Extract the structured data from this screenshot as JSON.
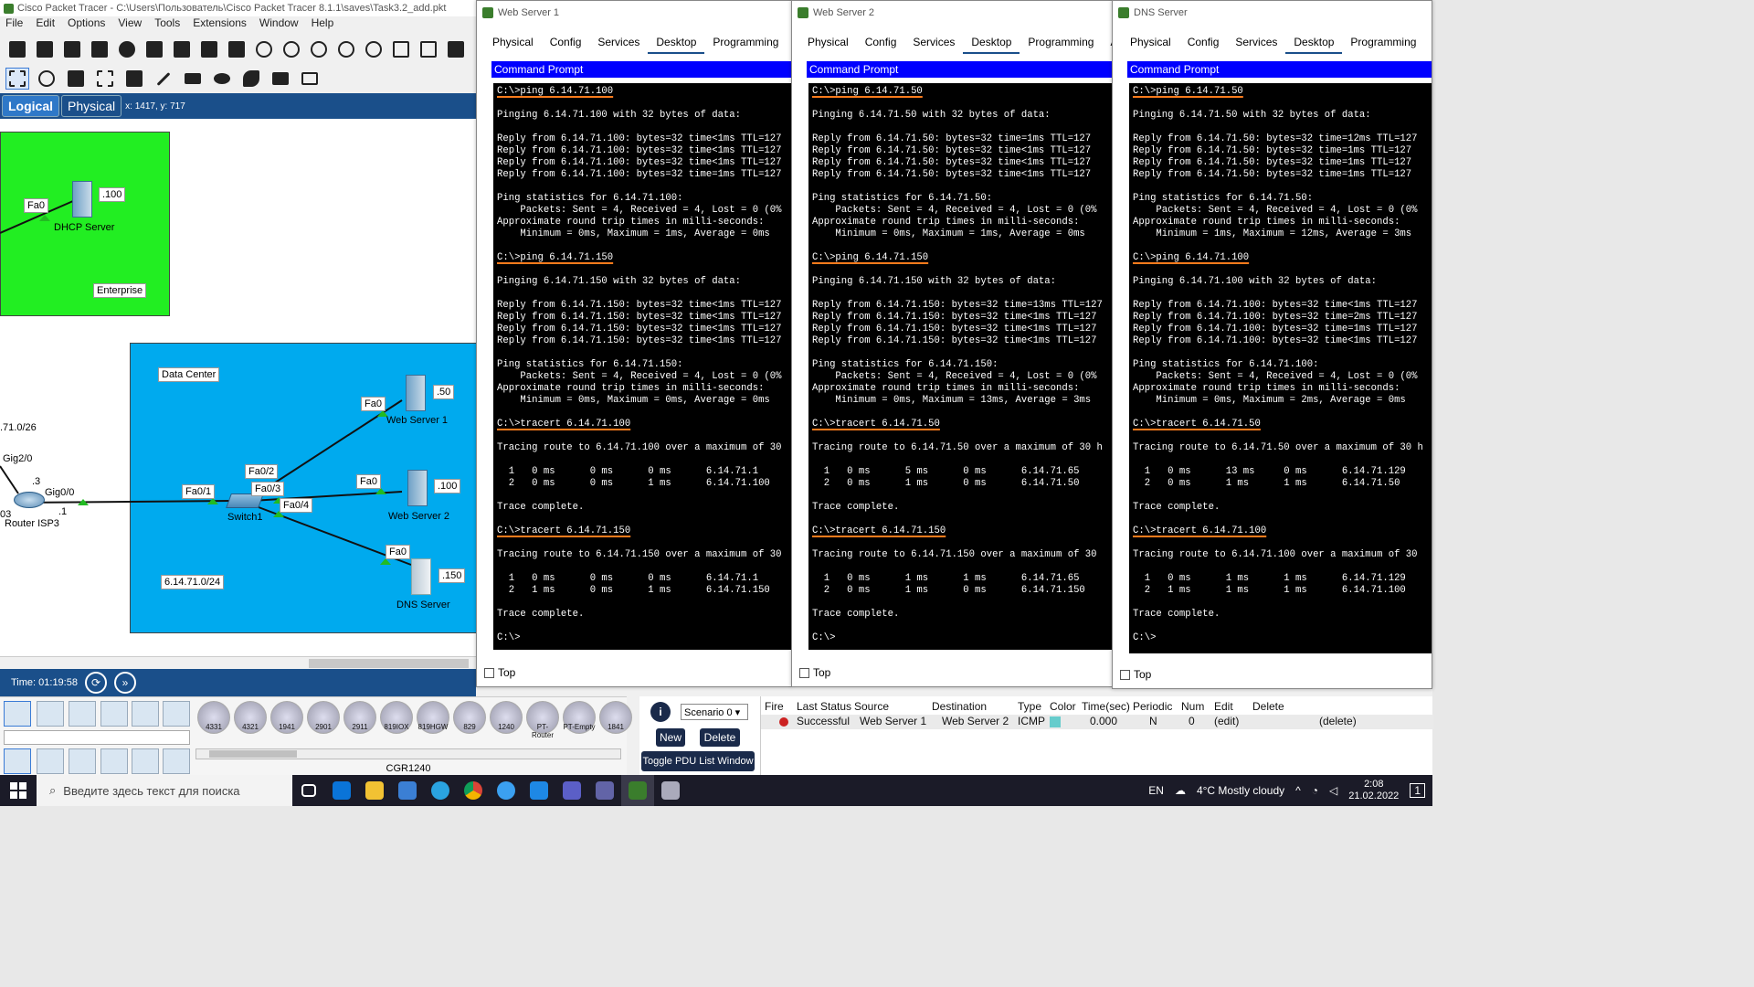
{
  "app": {
    "title": "Cisco Packet Tracer - C:\\Users\\Пользователь\\Cisco Packet Tracer 8.1.1\\saves\\Task3.2_add.pkt",
    "menu": [
      "File",
      "Edit",
      "Options",
      "View",
      "Tools",
      "Extensions",
      "Window",
      "Help"
    ],
    "mode_tabs": {
      "logical": "Logical",
      "physical": "Physical"
    },
    "coords": "x: 1417, y: 717",
    "time": "Time: 01:19:58"
  },
  "topology": {
    "zones": {
      "enterprise": "Enterprise",
      "datacenter": "Data Center",
      "subnet": "6.14.71.0/24",
      "isp_net": ".71.0/26"
    },
    "dhcp": {
      "name": "DHCP Server",
      "ip": ".100",
      "port": "Fa0"
    },
    "web1": {
      "name": "Web Server 1",
      "ip": ".50",
      "port": "Fa0"
    },
    "web2": {
      "name": "Web Server 2",
      "ip": ".100",
      "port": "Fa0"
    },
    "dns": {
      "name": "DNS Server",
      "ip": ".150",
      "port": "Fa0"
    },
    "switch": {
      "name": "Switch1",
      "p1": "Fa0/1",
      "p2": "Fa0/2",
      "p3": "Fa0/3",
      "p4": "Fa0/4"
    },
    "router": {
      "name": "Router ISP3",
      "g20": "Gig2/0",
      "g00": "Gig0/0",
      "a3": ".3",
      "a1": ".1",
      "a03": "03"
    }
  },
  "devices": {
    "models": [
      "4331",
      "4321",
      "1941",
      "2901",
      "2911",
      "819IOX",
      "819HGW",
      "829",
      "1240",
      "PT-Router",
      "PT-Empty",
      "1841"
    ],
    "selected": "CGR1240"
  },
  "scenario": {
    "select": "Scenario 0",
    "new": "New",
    "delete": "Delete",
    "toggle": "Toggle PDU List Window"
  },
  "pdu": {
    "headers": [
      "Fire",
      "Last Status",
      "Source",
      "Destination",
      "Type",
      "Color",
      "Time(sec)",
      "Periodic",
      "Num",
      "Edit",
      "Delete"
    ],
    "row": {
      "status": "Successful",
      "source": "Web Server 1",
      "dest": "Web Server 2",
      "type": "ICMP",
      "color": "#66cccc",
      "time": "0.000",
      "periodic": "N",
      "num": "0",
      "edit": "(edit)",
      "delete": "(delete)"
    }
  },
  "win_tabs": [
    "Physical",
    "Config",
    "Services",
    "Desktop",
    "Programming",
    "Attri"
  ],
  "windows": [
    {
      "title": "Web Server 1",
      "cmd": "Command Prompt",
      "top": "Top",
      "lines": [
        "C:\\>ping 6.14.71.100",
        "",
        "Pinging 6.14.71.100 with 32 bytes of data:",
        "",
        "Reply from 6.14.71.100: bytes=32 time<1ms TTL=127",
        "Reply from 6.14.71.100: bytes=32 time<1ms TTL=127",
        "Reply from 6.14.71.100: bytes=32 time<1ms TTL=127",
        "Reply from 6.14.71.100: bytes=32 time=1ms TTL=127",
        "",
        "Ping statistics for 6.14.71.100:",
        "    Packets: Sent = 4, Received = 4, Lost = 0 (0%",
        "Approximate round trip times in milli-seconds:",
        "    Minimum = 0ms, Maximum = 1ms, Average = 0ms",
        "",
        "C:\\>ping 6.14.71.150",
        "",
        "Pinging 6.14.71.150 with 32 bytes of data:",
        "",
        "Reply from 6.14.71.150: bytes=32 time<1ms TTL=127",
        "Reply from 6.14.71.150: bytes=32 time<1ms TTL=127",
        "Reply from 6.14.71.150: bytes=32 time<1ms TTL=127",
        "Reply from 6.14.71.150: bytes=32 time<1ms TTL=127",
        "",
        "Ping statistics for 6.14.71.150:",
        "    Packets: Sent = 4, Received = 4, Lost = 0 (0%",
        "Approximate round trip times in milli-seconds:",
        "    Minimum = 0ms, Maximum = 0ms, Average = 0ms",
        "",
        "C:\\>tracert 6.14.71.100",
        "",
        "Tracing route to 6.14.71.100 over a maximum of 30",
        "",
        "  1   0 ms      0 ms      0 ms      6.14.71.1",
        "  2   0 ms      0 ms      1 ms      6.14.71.100",
        "",
        "Trace complete.",
        "",
        "C:\\>tracert 6.14.71.150",
        "",
        "Tracing route to 6.14.71.150 over a maximum of 30",
        "",
        "  1   0 ms      0 ms      0 ms      6.14.71.1",
        "  2   1 ms      0 ms      1 ms      6.14.71.150",
        "",
        "Trace complete.",
        "",
        "C:\\>"
      ]
    },
    {
      "title": "Web Server 2",
      "cmd": "Command Prompt",
      "top": "Top",
      "lines": [
        "C:\\>ping 6.14.71.50",
        "",
        "Pinging 6.14.71.50 with 32 bytes of data:",
        "",
        "Reply from 6.14.71.50: bytes=32 time=1ms TTL=127",
        "Reply from 6.14.71.50: bytes=32 time<1ms TTL=127",
        "Reply from 6.14.71.50: bytes=32 time<1ms TTL=127",
        "Reply from 6.14.71.50: bytes=32 time<1ms TTL=127",
        "",
        "Ping statistics for 6.14.71.50:",
        "    Packets: Sent = 4, Received = 4, Lost = 0 (0%",
        "Approximate round trip times in milli-seconds:",
        "    Minimum = 0ms, Maximum = 1ms, Average = 0ms",
        "",
        "C:\\>ping 6.14.71.150",
        "",
        "Pinging 6.14.71.150 with 32 bytes of data:",
        "",
        "Reply from 6.14.71.150: bytes=32 time=13ms TTL=127",
        "Reply from 6.14.71.150: bytes=32 time<1ms TTL=127",
        "Reply from 6.14.71.150: bytes=32 time<1ms TTL=127",
        "Reply from 6.14.71.150: bytes=32 time<1ms TTL=127",
        "",
        "Ping statistics for 6.14.71.150:",
        "    Packets: Sent = 4, Received = 4, Lost = 0 (0%",
        "Approximate round trip times in milli-seconds:",
        "    Minimum = 0ms, Maximum = 13ms, Average = 3ms",
        "",
        "C:\\>tracert 6.14.71.50",
        "",
        "Tracing route to 6.14.71.50 over a maximum of 30 h",
        "",
        "  1   0 ms      5 ms      0 ms      6.14.71.65",
        "  2   0 ms      1 ms      0 ms      6.14.71.50",
        "",
        "Trace complete.",
        "",
        "C:\\>tracert 6.14.71.150",
        "",
        "Tracing route to 6.14.71.150 over a maximum of 30",
        "",
        "  1   0 ms      1 ms      1 ms      6.14.71.65",
        "  2   0 ms      1 ms      0 ms      6.14.71.150",
        "",
        "Trace complete.",
        "",
        "C:\\>"
      ]
    },
    {
      "title": "DNS Server",
      "cmd": "Command Prompt",
      "top": "Top",
      "lines": [
        "C:\\>ping 6.14.71.50",
        "",
        "Pinging 6.14.71.50 with 32 bytes of data:",
        "",
        "Reply from 6.14.71.50: bytes=32 time=12ms TTL=127",
        "Reply from 6.14.71.50: bytes=32 time=1ms TTL=127",
        "Reply from 6.14.71.50: bytes=32 time=1ms TTL=127",
        "Reply from 6.14.71.50: bytes=32 time=1ms TTL=127",
        "",
        "Ping statistics for 6.14.71.50:",
        "    Packets: Sent = 4, Received = 4, Lost = 0 (0%",
        "Approximate round trip times in milli-seconds:",
        "    Minimum = 1ms, Maximum = 12ms, Average = 3ms",
        "",
        "C:\\>ping 6.14.71.100",
        "",
        "Pinging 6.14.71.100 with 32 bytes of data:",
        "",
        "Reply from 6.14.71.100: bytes=32 time<1ms TTL=127",
        "Reply from 6.14.71.100: bytes=32 time=2ms TTL=127",
        "Reply from 6.14.71.100: bytes=32 time=1ms TTL=127",
        "Reply from 6.14.71.100: bytes=32 time<1ms TTL=127",
        "",
        "Ping statistics for 6.14.71.100:",
        "    Packets: Sent = 4, Received = 4, Lost = 0 (0%",
        "Approximate round trip times in milli-seconds:",
        "    Minimum = 0ms, Maximum = 2ms, Average = 0ms",
        "",
        "C:\\>tracert 6.14.71.50",
        "",
        "Tracing route to 6.14.71.50 over a maximum of 30 h",
        "",
        "  1   0 ms      13 ms     0 ms      6.14.71.129",
        "  2   0 ms      1 ms      1 ms      6.14.71.50",
        "",
        "Trace complete.",
        "",
        "C:\\>tracert 6.14.71.100",
        "",
        "Tracing route to 6.14.71.100 over a maximum of 30",
        "",
        "  1   0 ms      1 ms      1 ms      6.14.71.129",
        "  2   1 ms      1 ms      1 ms      6.14.71.100",
        "",
        "Trace complete.",
        "",
        "C:\\>"
      ]
    }
  ],
  "taskbar": {
    "search": "Введите здесь текст для поиска",
    "lang": "EN",
    "weather": "4°C  Mostly cloudy",
    "time": "2:08",
    "date": "21.02.2022",
    "notif": "1"
  }
}
